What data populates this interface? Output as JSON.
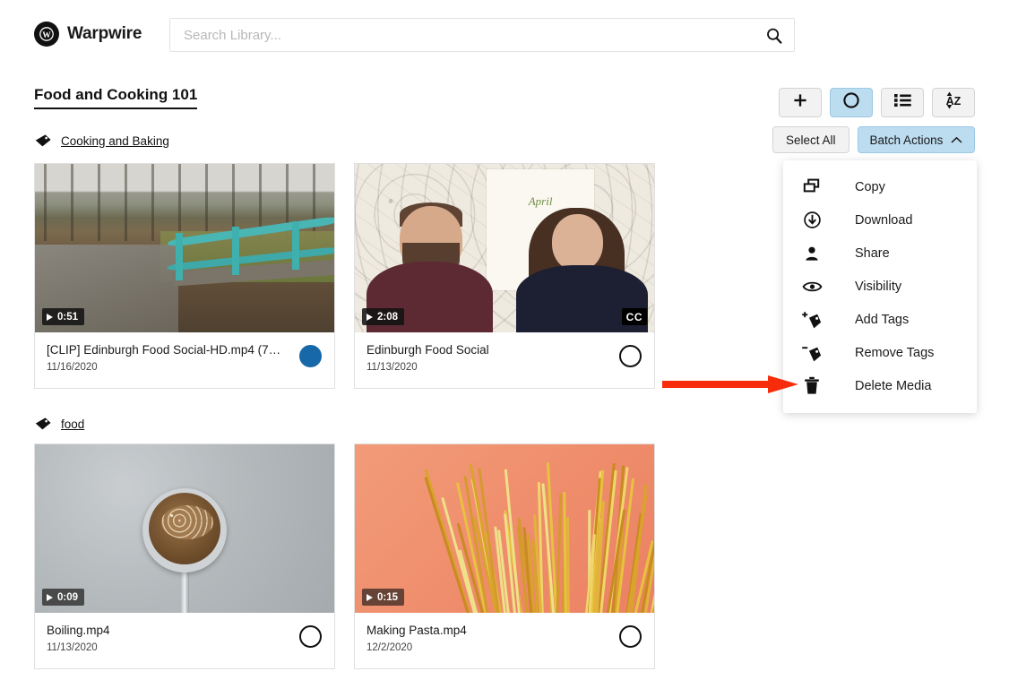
{
  "header": {
    "brand_name": "Warpwire",
    "brand_icon": "warpwire-logo-icon",
    "search": {
      "value": "",
      "placeholder": "Search Library...",
      "icon": "search-icon"
    }
  },
  "collection": {
    "title": "Food and Cooking 101"
  },
  "toolbar": {
    "icon_buttons": [
      {
        "name": "add-media-button",
        "icon": "plus-icon",
        "active": false
      },
      {
        "name": "grid-view-button",
        "icon": "circle-icon",
        "active": true
      },
      {
        "name": "list-view-button",
        "icon": "list-icon",
        "active": false
      },
      {
        "name": "sort-button",
        "icon": "sort-az-icon",
        "active": false
      }
    ],
    "select_all_label": "Select All",
    "batch_actions_label": "Batch Actions",
    "batch_actions_caret": "chevron-up-icon",
    "accent_active": "#bcdcf0",
    "accent_selected": "#1668a8"
  },
  "batch_menu": {
    "open": true,
    "items": [
      {
        "label": "Copy",
        "icon": "copy-icon"
      },
      {
        "label": "Download",
        "icon": "download-circle-icon"
      },
      {
        "label": "Share",
        "icon": "person-icon"
      },
      {
        "label": "Visibility",
        "icon": "eye-icon"
      },
      {
        "label": "Add Tags",
        "icon": "tag-plus-icon"
      },
      {
        "label": "Remove Tags",
        "icon": "tag-minus-icon"
      },
      {
        "label": "Delete Media",
        "icon": "trash-icon"
      }
    ]
  },
  "annotation": {
    "type": "arrow",
    "color": "#f72c0b",
    "points_to": "Delete Media"
  },
  "groups": [
    {
      "tag_label": "Cooking and Baking",
      "tag_icon": "tag-icon",
      "cards": [
        {
          "title": "[CLIP] Edinburgh Food Social-HD.mp4 (72…",
          "date": "11/16/2020",
          "duration": "0:51",
          "captions": false,
          "selected": true,
          "thumb": "bridge-landscape-thumbnail"
        },
        {
          "title": "Edinburgh Food Social",
          "date": "11/13/2020",
          "duration": "2:08",
          "captions": true,
          "captions_label": "CC",
          "selected": false,
          "thumb": "interview-two-people-thumbnail"
        }
      ]
    },
    {
      "tag_label": "food",
      "tag_icon": "tag-icon",
      "cards": [
        {
          "title": "Boiling.mp4",
          "date": "11/13/2020",
          "duration": "0:09",
          "captions": false,
          "selected": false,
          "thumb": "saucepan-boiling-thumbnail"
        },
        {
          "title": "Making Pasta.mp4",
          "date": "12/2/2020",
          "duration": "0:15",
          "captions": false,
          "selected": false,
          "thumb": "spaghetti-thumbnail"
        }
      ]
    }
  ]
}
